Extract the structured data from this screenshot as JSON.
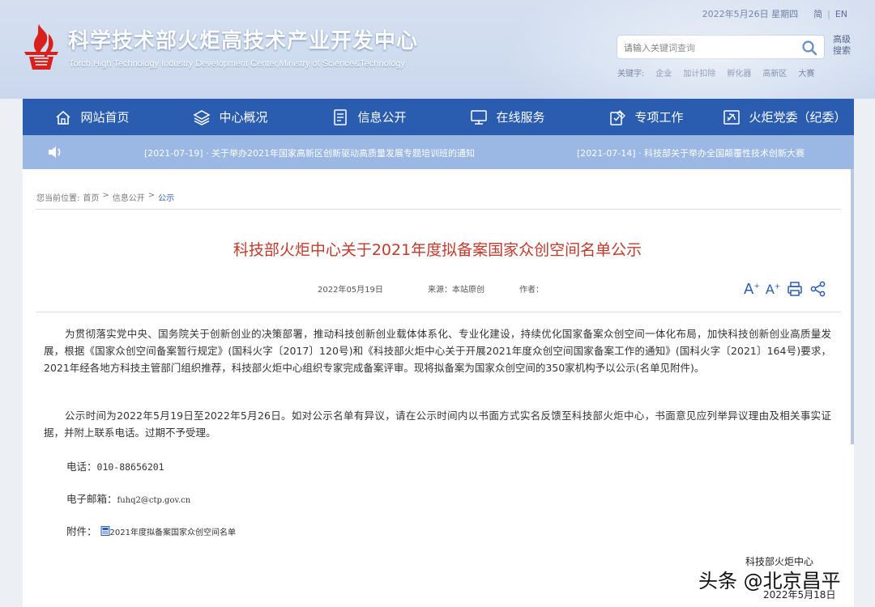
{
  "header": {
    "title": "科学技术部火炬高技术产业开发中心",
    "subtitle": "Torch High Technology Industry Development Center,Ministry of Science&Technology",
    "date": "2022年5月26日 星期四",
    "lang_cn": "简",
    "lang_sep": "|",
    "lang_en": "EN",
    "search_placeholder": "请输入关键词查询",
    "advanced_search": "高级搜索",
    "keywords_label": "关键字:",
    "keywords": [
      "企业",
      "加计扣除",
      "孵化器",
      "高新区",
      "大赛"
    ]
  },
  "nav": {
    "items": [
      {
        "label": "网站首页",
        "icon": "home-icon"
      },
      {
        "label": "中心概况",
        "icon": "layers-icon"
      },
      {
        "label": "信息公开",
        "icon": "document-icon"
      },
      {
        "label": "在线服务",
        "icon": "monitor-icon"
      },
      {
        "label": "专项工作",
        "icon": "clipboard-icon"
      },
      {
        "label": "火炬党委（纪委）",
        "icon": "party-icon"
      }
    ]
  },
  "ticker": {
    "items": [
      "[2021-07-19] · 关于举办2021年国家高新区创新驱动高质量发展专题培训班的通知",
      "[2021-07-14] · 科技部关于举办全国颠覆性技术创新大赛"
    ]
  },
  "breadcrumb": {
    "label": "您当前位置:",
    "items": [
      "首页",
      "信息公开",
      "公示"
    ],
    "sep": ">"
  },
  "article": {
    "title": "科技部火炬中心关于2021年度拟备案国家众创空间名单公示",
    "date": "2022年05月19日",
    "source": "来源：本站原创",
    "author": "作者：",
    "font_large": "A",
    "font_small": "A",
    "paragraphs": [
      "为贯彻落实党中央、国务院关于创新创业的决策部署，推动科技创新创业载体体系化、专业化建设，持续优化国家备案众创空间一体化布局，加快科技创新创业高质量发展，根据《国家众创空间备案暂行规定》(国科火字〔2017〕120号)和《科技部火炬中心关于开展2021年度众创空间国家备案工作的通知》(国科火字〔2021〕164号)要求，2021年经各地方科技主管部门组织推荐，科技部火炬中心组织专家完成备案评审。现将拟备案为国家众创空间的350家机构予以公示(名单见附件)。",
      "公示时间为2022年5月19日至2022年5月26日。如对公示名单有异议，请在公示时间内以书面方式实名反馈至科技部火炬中心，书面意见应列举异议理由及相关事实证据，并附上联系电话。过期不予受理。"
    ],
    "phone_label": "电话：",
    "phone": "010-88656201",
    "email_label": "电子邮箱：",
    "email": "fuhq2@ctp.gov.cn",
    "attachment_label": "附件：",
    "attachment": "2021年度拟备案国家众创空间名单"
  },
  "watermark": {
    "org": "科技部火炬中心",
    "brand": "头条 @北京昌平",
    "date": "2022年5月18日"
  },
  "colors": {
    "nav": "#2a5db0",
    "ticker": "#9bb7e4",
    "title_red": "#c0392b",
    "logo_red": "#d9201a"
  }
}
